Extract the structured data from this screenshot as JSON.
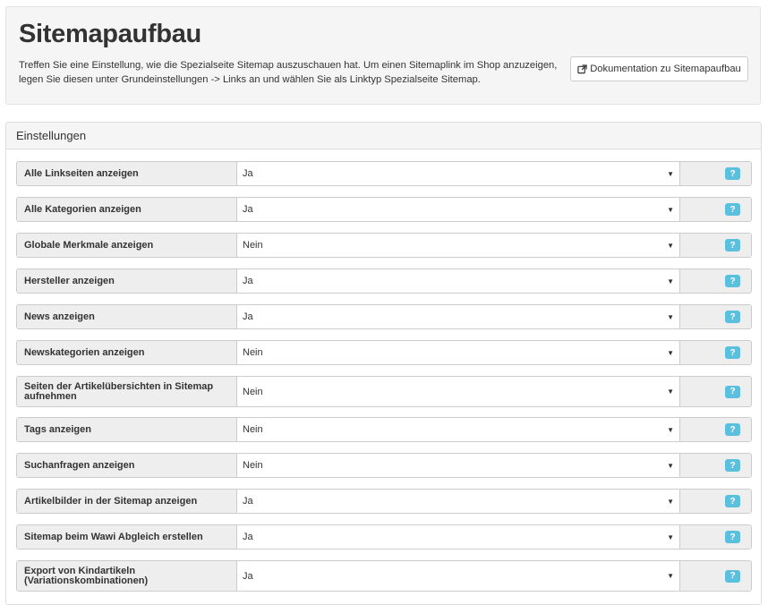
{
  "header": {
    "title": "Sitemapaufbau",
    "description": "Treffen Sie eine Einstellung, wie die Spezialseite Sitemap auszuschauen hat. Um einen Sitemaplink im Shop anzuzeigen, legen Sie diesen unter Grundeinstellungen -> Links an und wählen Sie als Linktyp Spezialseite Sitemap.",
    "doc_button_label": "Dokumentation zu Sitemapaufbau",
    "doc_button_icon": "external-link-icon"
  },
  "panel": {
    "heading": "Einstellungen",
    "help_label": "?",
    "settings": [
      {
        "label": "Alle Linkseiten anzeigen",
        "value": "Ja"
      },
      {
        "label": "Alle Kategorien anzeigen",
        "value": "Ja"
      },
      {
        "label": "Globale Merkmale anzeigen",
        "value": "Nein"
      },
      {
        "label": "Hersteller anzeigen",
        "value": "Ja"
      },
      {
        "label": "News anzeigen",
        "value": "Ja"
      },
      {
        "label": "Newskategorien anzeigen",
        "value": "Nein"
      },
      {
        "label": "Seiten der Artikelübersichten in Sitemap aufnehmen",
        "value": "Nein"
      },
      {
        "label": "Tags anzeigen",
        "value": "Nein"
      },
      {
        "label": "Suchanfragen anzeigen",
        "value": "Nein"
      },
      {
        "label": "Artikelbilder in der Sitemap anzeigen",
        "value": "Ja"
      },
      {
        "label": "Sitemap beim Wawi Abgleich erstellen",
        "value": "Ja"
      },
      {
        "label": "Export von Kindartikeln (Variationskombinationen)",
        "value": "Ja"
      }
    ]
  },
  "colors": {
    "help_badge": "#5bc0de",
    "addon_background": "#eeeeee",
    "header_background": "#f5f5f5"
  }
}
